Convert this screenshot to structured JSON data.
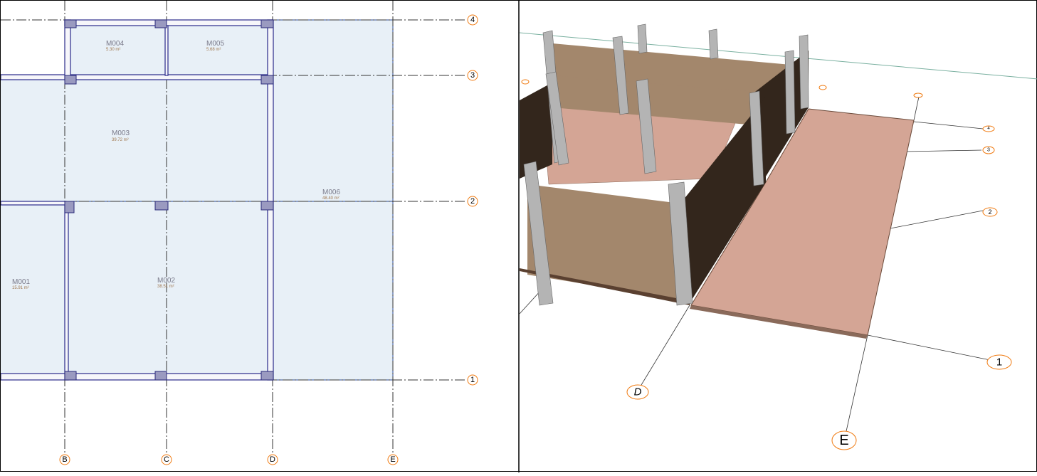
{
  "plan": {
    "rooms": [
      {
        "name": "M004",
        "area": "5.30 m²"
      },
      {
        "name": "M005",
        "area": "5.68 m²"
      },
      {
        "name": "M003",
        "area": "39.72 m²"
      },
      {
        "name": "M006",
        "area": "48.40 m²"
      },
      {
        "name": "M001",
        "area": "15.91 m²"
      },
      {
        "name": "M002",
        "area": "38.51 m²"
      }
    ],
    "row_axes": [
      "4",
      "3",
      "2",
      "1"
    ],
    "col_axes": [
      "B",
      "C",
      "D",
      "E"
    ]
  },
  "view3d": {
    "row_axes": [
      "4",
      "3",
      "2",
      "1"
    ],
    "col_axes": [
      "D",
      "E"
    ]
  },
  "colors": {
    "bubble": "#f07a10",
    "room_fill": "#e8f0f7",
    "floor": "#d4a595",
    "wall": "#a3876c",
    "wall_dark": "#33261c",
    "column": "#b4b4b4"
  }
}
